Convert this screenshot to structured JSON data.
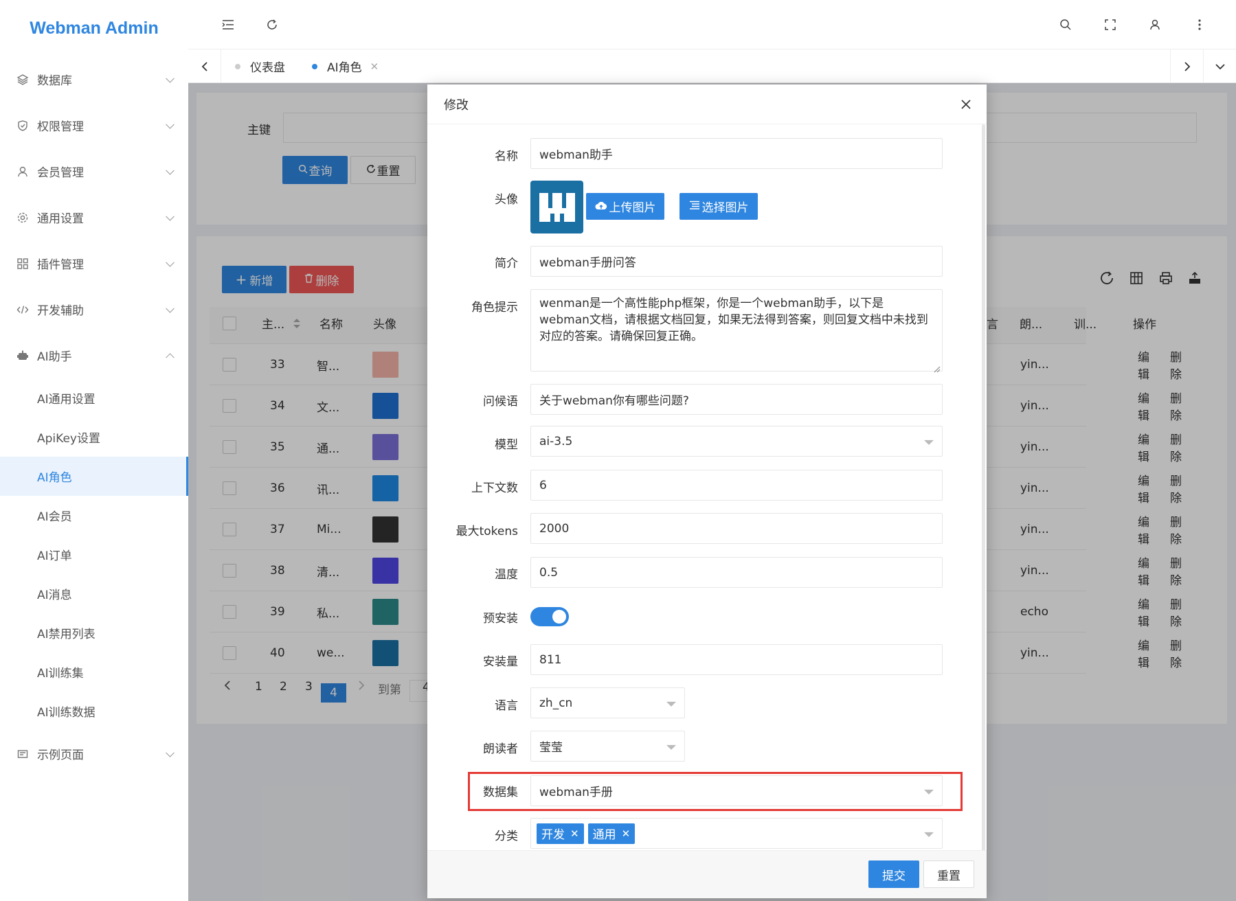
{
  "app": {
    "title": "Webman Admin"
  },
  "sidebar": {
    "items": [
      {
        "label": "数据库"
      },
      {
        "label": "权限管理"
      },
      {
        "label": "会员管理"
      },
      {
        "label": "通用设置"
      },
      {
        "label": "插件管理"
      },
      {
        "label": "开发辅助"
      },
      {
        "label": "AI助手"
      }
    ],
    "ai_sub": [
      {
        "label": "AI通用设置"
      },
      {
        "label": "ApiKey设置"
      },
      {
        "label": "AI角色"
      },
      {
        "label": "AI会员"
      },
      {
        "label": "AI订单"
      },
      {
        "label": "AI消息"
      },
      {
        "label": "AI禁用列表"
      },
      {
        "label": "AI训练集"
      },
      {
        "label": "AI训练数据"
      }
    ],
    "last": {
      "label": "示例页面"
    }
  },
  "tabs": [
    {
      "label": "仪表盘"
    },
    {
      "label": "AI角色"
    }
  ],
  "search": {
    "key_label": "主键",
    "query": "查询",
    "reset": "重置"
  },
  "toolbar": {
    "add": "新增",
    "delete": "删除"
  },
  "table": {
    "headers": {
      "id": "主...",
      "name": "名称",
      "avatar": "头像",
      "c1": "言",
      "reader": "朗...",
      "train": "训...",
      "ops": "操作"
    },
    "rows": [
      {
        "id": "33",
        "name": "智...",
        "reader": "yin..."
      },
      {
        "id": "34",
        "name": "文...",
        "reader": "yin..."
      },
      {
        "id": "35",
        "name": "通...",
        "reader": "yin..."
      },
      {
        "id": "36",
        "name": "讯...",
        "reader": "yin..."
      },
      {
        "id": "37",
        "name": "Mi...",
        "reader": "yin..."
      },
      {
        "id": "38",
        "name": "清...",
        "reader": "yin..."
      },
      {
        "id": "39",
        "name": "私...",
        "reader": "echo"
      },
      {
        "id": "40",
        "name": "we...",
        "reader": "yin..."
      }
    ],
    "row_edit": "编辑",
    "row_delete": "删除",
    "avatar_colors": [
      "#f3b3a8",
      "#1f6fd1",
      "#7b6fd6",
      "#1e88e5",
      "#333333",
      "#4f46e5",
      "#2b8a8a",
      "#1a6fa3"
    ]
  },
  "pager": {
    "pages": [
      "1",
      "2",
      "3",
      "4"
    ],
    "current": "4",
    "goto": "到第",
    "goto_value": "4"
  },
  "modal": {
    "title": "修改",
    "fields": {
      "name": {
        "label": "名称",
        "value": "webman助手"
      },
      "avatar": {
        "label": "头像",
        "upload": "上传图片",
        "choose": "选择图片"
      },
      "desc": {
        "label": "简介",
        "value": "webman手册问答"
      },
      "prompt": {
        "label": "角色提示",
        "value": "wenman是一个高性能php框架，你是一个webman助手，以下是webman文档，请根据文档回复，如果无法得到答案，则回复文档中未找到对应的答案。请确保回复正确。"
      },
      "greeting": {
        "label": "问候语",
        "value": "关于webman你有哪些问题?"
      },
      "model": {
        "label": "模型",
        "value": "ai-3.5"
      },
      "context": {
        "label": "上下文数",
        "value": "6"
      },
      "max_tokens": {
        "label": "最大tokens",
        "value": "2000"
      },
      "temperature": {
        "label": "温度",
        "value": "0.5"
      },
      "preinstall": {
        "label": "预安装",
        "on": true
      },
      "installs": {
        "label": "安装量",
        "value": "811"
      },
      "language": {
        "label": "语言",
        "value": "zh_cn"
      },
      "reader": {
        "label": "朗读者",
        "value": "莹莹"
      },
      "dataset": {
        "label": "数据集",
        "value": "webman手册"
      },
      "category": {
        "label": "分类",
        "tags": [
          "开发",
          "通用"
        ]
      }
    },
    "submit": "提交",
    "reset": "重置"
  },
  "colors": {
    "accent": "#2f86e0",
    "danger": "#f05656",
    "highlight": "#e53935"
  }
}
